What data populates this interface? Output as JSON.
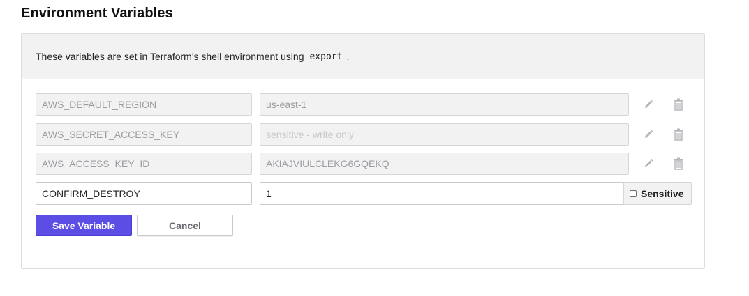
{
  "page": {
    "title": "Environment Variables"
  },
  "panel": {
    "description_before": "These variables are set in Terraform's shell environment using",
    "description_code": "export",
    "description_after": "."
  },
  "variables": [
    {
      "key": "AWS_DEFAULT_REGION",
      "value": "us-east-1",
      "value_is_placeholder": false
    },
    {
      "key": "AWS_SECRET_ACCESS_KEY",
      "value": "sensitive - write only",
      "value_is_placeholder": true
    },
    {
      "key": "AWS_ACCESS_KEY_ID",
      "value": "AKIAJVIULCLEKG6GQEKQ",
      "value_is_placeholder": false
    }
  ],
  "new_variable": {
    "key": "CONFIRM_DESTROY",
    "value": "1",
    "sensitive_label": "Sensitive",
    "sensitive_checked": false
  },
  "actions": {
    "save_label": "Save Variable",
    "cancel_label": "Cancel"
  },
  "icons": {
    "edit": "pencil-icon",
    "delete": "trash-icon"
  },
  "colors": {
    "primary": "#5c4ee5",
    "icon": "#b5b7bb",
    "panel_header_bg": "#f2f2f2"
  }
}
